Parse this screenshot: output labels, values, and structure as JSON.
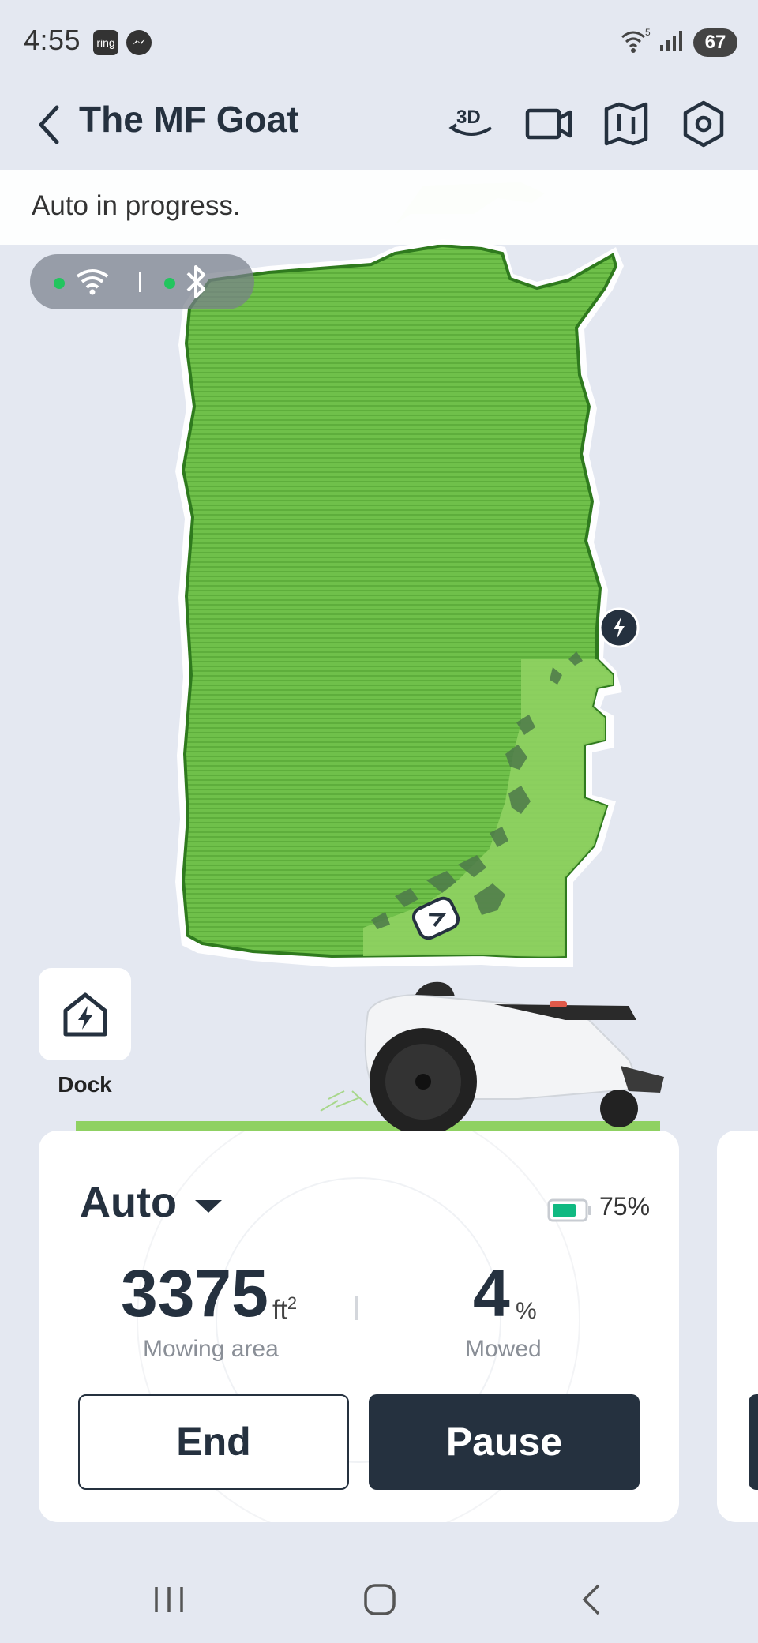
{
  "status_bar": {
    "time": "4:55",
    "notifications": [
      {
        "name": "ring-notification-icon",
        "text": "ring"
      },
      {
        "name": "messenger-notification-icon",
        "text": ""
      }
    ],
    "wifi_badge": "5",
    "battery_level": "67"
  },
  "header": {
    "title": "The MF Goat",
    "view_3d_label": "3D",
    "icons": [
      "back-icon",
      "3d-view-icon",
      "camera-icon",
      "map-icon",
      "settings-icon"
    ]
  },
  "banner": {
    "text": "Auto in progress."
  },
  "connection": {
    "wifi_connected": true,
    "bluetooth_connected": true,
    "status_color": "#22c55e"
  },
  "map": {
    "lawn_color": "#8fd162",
    "mowed_color": "#5cb634",
    "border_color": "#2f7a1e"
  },
  "dock": {
    "label": "Dock"
  },
  "control_card": {
    "mode": "Auto",
    "battery_percent_text": "75%",
    "battery_level": 0.75,
    "area_value": "3375",
    "area_unit": "ft",
    "area_unit_sup": "2",
    "area_label": "Mowing area",
    "mowed_value": "4",
    "mowed_unit": "%",
    "mowed_label": "Mowed",
    "end_label": "End",
    "pause_label": "Pause"
  },
  "colors": {
    "dark": "#25313f",
    "background": "#e4e8f1",
    "accent_green": "#22c55e"
  }
}
